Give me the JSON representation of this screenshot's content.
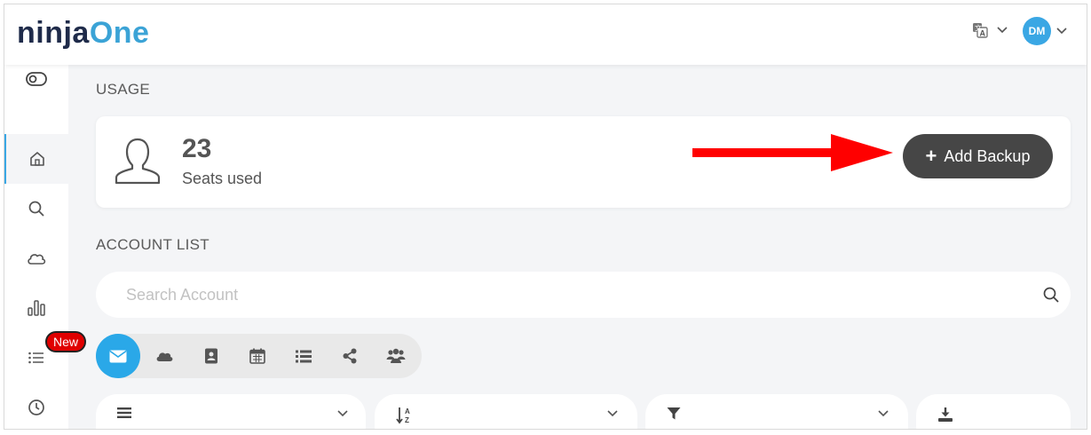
{
  "header": {
    "logo_part1": "ninja",
    "logo_part2": "One",
    "language_icon": "translate-icon",
    "avatar_initials": "DM"
  },
  "sidebar": {
    "items": [
      {
        "icon": "toggle-icon"
      },
      {
        "icon": "home-icon",
        "active": true
      },
      {
        "icon": "search-icon"
      },
      {
        "icon": "cloud-icon"
      },
      {
        "icon": "bar-chart-icon"
      },
      {
        "icon": "list-icon"
      },
      {
        "icon": "clock-icon"
      }
    ],
    "new_badge": "New"
  },
  "usage": {
    "section_title": "USAGE",
    "seat_count": "23",
    "seat_label": "Seats used",
    "add_backup_label": "Add Backup"
  },
  "account_list": {
    "section_title": "ACCOUNT LIST",
    "search_placeholder": "Search Account",
    "filter_buttons": [
      "mail-icon",
      "cloud-icon",
      "contacts-icon",
      "calendar-icon",
      "tasks-list-icon",
      "share-icon",
      "groups-icon"
    ],
    "dropdowns": [
      "menu-icon",
      "sort-az-icon",
      "filter-icon",
      "download-icon"
    ]
  },
  "colors": {
    "accent": "#3aa7e4",
    "logo_dark": "#1f2b4a",
    "logo_blue": "#3ba3d6",
    "add_button_bg": "#464646",
    "arrow_red": "#ff0000",
    "badge_red": "#e00000"
  }
}
